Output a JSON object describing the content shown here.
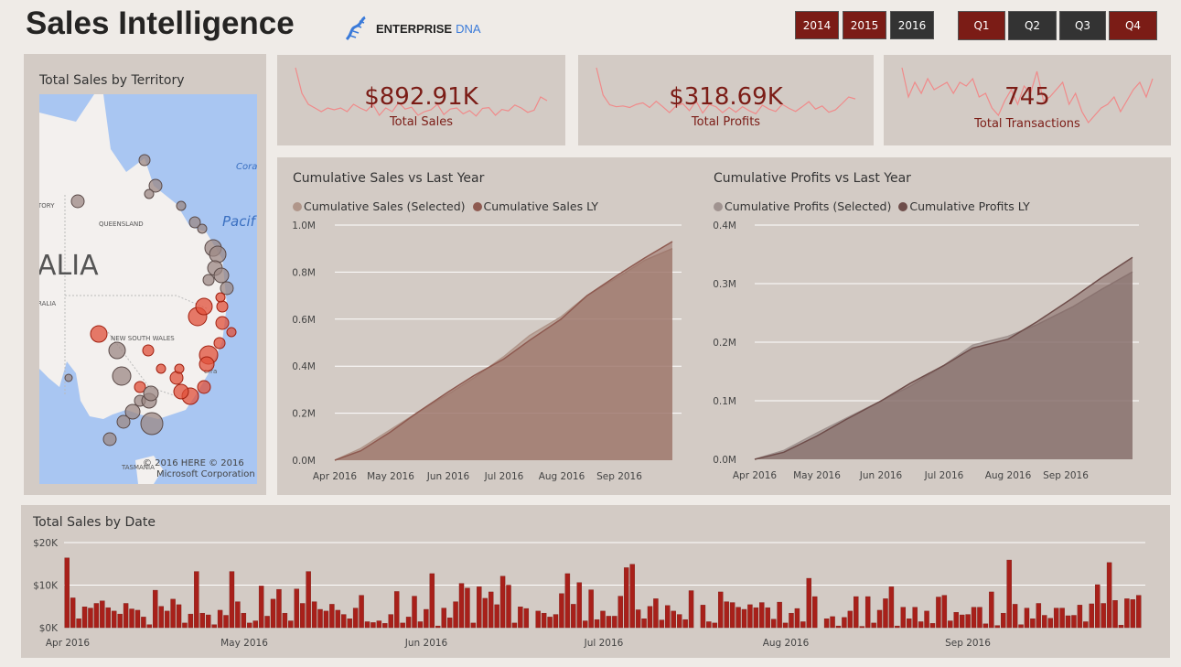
{
  "header": {
    "title": "Sales Intelligence",
    "logo_text_1": "ENTERPRISE",
    "logo_text_2": "DNA"
  },
  "filters": {
    "years": [
      {
        "label": "2014",
        "selected": true
      },
      {
        "label": "2015",
        "selected": true
      },
      {
        "label": "2016",
        "selected": false
      }
    ],
    "quarters": [
      {
        "label": "Q1",
        "selected": true
      },
      {
        "label": "Q2",
        "selected": false
      },
      {
        "label": "Q3",
        "selected": false
      },
      {
        "label": "Q4",
        "selected": true
      }
    ]
  },
  "colors": {
    "accent": "#7b1c16",
    "bar": "#a8201a",
    "panel": "#d3cbc5",
    "background": "#efebe7",
    "sparkline": "#f08a8a"
  },
  "map": {
    "title": "Total Sales by Territory",
    "labels": {
      "territory": "TORY",
      "queensland": "QUEENSLAND",
      "australia": "ALIA",
      "south_australia": "RALIA",
      "nsw": "NEW SOUTH WALES",
      "canberra": "erra",
      "victoria": "VI",
      "tasmania": "TASMANIA",
      "coral": "Cora",
      "pacific": "Pacif"
    },
    "copyright_1": "© 2016 HERE    © 2016",
    "copyright_2": "Microsoft Corporation"
  },
  "kpis": [
    {
      "value": "$892.91K",
      "label": "Total Sales",
      "spark": [
        16,
        9,
        6,
        5,
        4,
        5,
        4.5,
        5,
        4,
        6,
        5,
        4.2,
        6,
        3,
        5,
        4,
        6.5,
        4.7,
        5.2,
        3,
        4,
        4.5,
        6,
        3.2,
        4.7,
        5,
        3.4,
        4.3,
        2.8,
        4.9,
        5.1,
        3,
        4.6,
        4.2,
        5.8,
        5,
        3.8,
        4.4,
        8,
        7
      ]
    },
    {
      "value": "$318.69K",
      "label": "Total Profits",
      "spark": [
        15,
        8,
        5.5,
        5,
        5.2,
        4.8,
        5.6,
        6,
        4.8,
        6.4,
        5,
        3.5,
        5.2,
        5.8,
        4,
        6.5,
        3.4,
        5.6,
        5,
        3.5,
        4.8,
        3.6,
        5,
        4,
        3.2,
        5.4,
        4.4,
        3.8,
        5.6,
        4.6,
        3.8,
        5,
        6.3,
        4.4,
        5.2,
        3.6,
        4.2,
        5.8,
        7.5,
        7
      ]
    },
    {
      "value": "745",
      "label": "Total Transactions",
      "spark": [
        16,
        8,
        12,
        9,
        13,
        10,
        11,
        12,
        9,
        12,
        11,
        13,
        8,
        9,
        5,
        3,
        7,
        10,
        6,
        11,
        9,
        15,
        7,
        8,
        10,
        12,
        6,
        9,
        4,
        1,
        3,
        5,
        6,
        8,
        4,
        7,
        10,
        12,
        8,
        13
      ]
    }
  ],
  "cum_sales": {
    "title": "Cumulative Sales vs Last Year",
    "legend": [
      "Cumulative Sales (Selected)",
      "Cumulative Sales LY"
    ]
  },
  "cum_profits": {
    "title": "Cumulative Profits vs Last Year",
    "legend": [
      "Cumulative Profits (Selected)",
      "Cumulative Profits LY"
    ]
  },
  "daily": {
    "title": "Total Sales by Date"
  },
  "chart_data": [
    {
      "type": "area",
      "title": "Cumulative Sales vs Last Year",
      "ylim": [
        0,
        1000000
      ],
      "yticks": [
        "0.0M",
        "0.2M",
        "0.4M",
        "0.6M",
        "0.8M",
        "1.0M"
      ],
      "xticks": [
        "Apr 2016",
        "May 2016",
        "Jun 2016",
        "Jul 2016",
        "Aug 2016",
        "Sep 2016"
      ],
      "x": [
        "2016-04-01",
        "2016-04-15",
        "2016-05-01",
        "2016-05-15",
        "2016-06-01",
        "2016-06-15",
        "2016-07-01",
        "2016-07-15",
        "2016-08-01",
        "2016-08-15",
        "2016-09-01",
        "2016-09-15",
        "2016-09-30"
      ],
      "series": [
        {
          "name": "Cumulative Sales (Selected)",
          "color": "#b0968a",
          "values": [
            0,
            50000,
            130000,
            200000,
            280000,
            350000,
            440000,
            530000,
            610000,
            700000,
            780000,
            850000,
            900000
          ]
        },
        {
          "name": "Cumulative Sales LY",
          "color": "#8e5a50",
          "values": [
            0,
            40000,
            120000,
            200000,
            290000,
            360000,
            430000,
            510000,
            600000,
            700000,
            790000,
            860000,
            930000
          ]
        }
      ]
    },
    {
      "type": "area",
      "title": "Cumulative Profits vs Last Year",
      "ylim": [
        0,
        400000
      ],
      "yticks": [
        "0.0M",
        "0.1M",
        "0.2M",
        "0.3M",
        "0.4M"
      ],
      "xticks": [
        "Apr 2016",
        "May 2016",
        "Jun 2016",
        "Jul 2016",
        "Aug 2016",
        "Sep 2016"
      ],
      "x": [
        "2016-04-01",
        "2016-04-15",
        "2016-05-01",
        "2016-05-15",
        "2016-06-01",
        "2016-06-15",
        "2016-07-01",
        "2016-07-15",
        "2016-08-01",
        "2016-08-15",
        "2016-09-01",
        "2016-09-15",
        "2016-09-30"
      ],
      "series": [
        {
          "name": "Cumulative Profits (Selected)",
          "color": "#a09390",
          "values": [
            0,
            15000,
            45000,
            70000,
            100000,
            125000,
            160000,
            195000,
            210000,
            230000,
            260000,
            290000,
            320000
          ]
        },
        {
          "name": "Cumulative Profits LY",
          "color": "#6e4d4a",
          "values": [
            0,
            12000,
            40000,
            68000,
            100000,
            130000,
            160000,
            190000,
            205000,
            235000,
            275000,
            310000,
            345000
          ]
        }
      ]
    },
    {
      "type": "bar",
      "title": "Total Sales by Date",
      "ylim": [
        0,
        20000
      ],
      "yticks": [
        "$0K",
        "$10K",
        "$20K"
      ],
      "xticks": [
        "Apr 2016",
        "May 2016",
        "Jun 2016",
        "Jul 2016",
        "Aug 2016",
        "Sep 2016"
      ],
      "unit": "$K",
      "values": [
        16.4,
        7,
        2.1,
        4.9,
        4.6,
        5.7,
        6.3,
        4.7,
        3.9,
        3.2,
        5.7,
        4.4,
        4.1,
        2.5,
        0.7,
        8.8,
        5,
        3.9,
        6.7,
        5.4,
        1.1,
        3.2,
        13.2,
        3.4,
        3,
        0.7,
        4.1,
        2.9,
        13.2,
        6.1,
        3.4,
        1.1,
        1.6,
        9.8,
        2.7,
        6.7,
        9,
        3.4,
        1.6,
        9.1,
        5.7,
        13.2,
        6.1,
        4.3,
        3.9,
        5.5,
        4.1,
        3.1,
        2.1,
        4.6,
        7.6,
        1.4,
        1.2,
        1.6,
        1,
        3.1,
        8.5,
        1.1,
        2.5,
        7.4,
        1.4,
        4.3,
        12.7,
        0.4,
        4.6,
        2.3,
        6.1,
        10.4,
        9.3,
        1.1,
        9.6,
        6.9,
        8.4,
        5.4,
        12.1,
        10,
        1.1,
        4.9,
        4.5,
        0,
        3.9,
        3.4,
        2.5,
        3.1,
        8,
        12.7,
        5.5,
        10.6,
        1.6,
        8.9,
        1.9,
        3.9,
        2.7,
        2.7,
        7.4,
        14.1,
        14.9,
        4.2,
        2.1,
        5,
        6.8,
        1.8,
        5.2,
        3.9,
        3.1,
        1.9,
        8.7,
        0,
        5.3,
        1.4,
        1.1,
        8.4,
        6.1,
        5.9,
        4.8,
        4.3,
        5.4,
        4.7,
        5.9,
        4.7,
        2,
        6,
        1.1,
        3.4,
        4.5,
        1.4,
        11.6,
        7.3,
        0,
        2.1,
        2.6,
        0.4,
        2.4,
        3.9,
        7.3,
        0.3,
        7.3,
        1.1,
        4.1,
        6.8,
        9.6,
        0.4,
        4.8,
        2.1,
        4.8,
        1.4,
        3.9,
        1,
        7.2,
        7.6,
        1.6,
        3.6,
        3,
        3.1,
        4.8,
        4.8,
        0.9,
        8.4,
        0.5,
        3.4,
        15.9,
        5.5,
        0.7,
        4.6,
        2.1,
        5.7,
        2.9,
        2.2,
        4.6,
        4.6,
        2.8,
        2.9,
        5.3,
        1.4,
        5.6,
        10.1,
        5.7,
        15.3,
        6.4,
        0.6,
        6.8,
        6.6,
        7.6
      ]
    }
  ]
}
